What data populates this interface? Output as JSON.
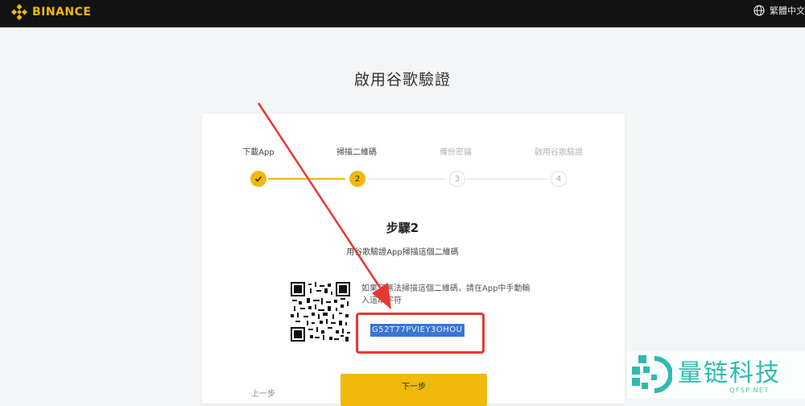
{
  "header": {
    "brand": "BINANCE",
    "language": "繁體中文"
  },
  "page": {
    "title": "啟用谷歌驗證"
  },
  "steps": [
    {
      "label": "下載App",
      "state": "done"
    },
    {
      "label": "掃描二維碼",
      "number": "2",
      "state": "active"
    },
    {
      "label": "備份密鑰",
      "number": "3",
      "state": "pending"
    },
    {
      "label": "啟用谷歌驗證",
      "number": "4",
      "state": "pending"
    }
  ],
  "content": {
    "heading": "步驟2",
    "description": "用谷歌驗證App掃描這個二維碼",
    "hint_line1": "如果您無法掃描這個二維碼，請在App中手動輸",
    "hint_line2": "入這串字符",
    "secret_key": "G52T77PVIEY3OHOU"
  },
  "buttons": {
    "prev": "上一步",
    "next": "下一步"
  },
  "watermark": {
    "text": "量链科技",
    "sub": "QFSP.NET"
  },
  "colors": {
    "brand": "#f0b90b",
    "topbar": "#121212",
    "highlight": "#e53935",
    "selection": "#3875d6"
  }
}
